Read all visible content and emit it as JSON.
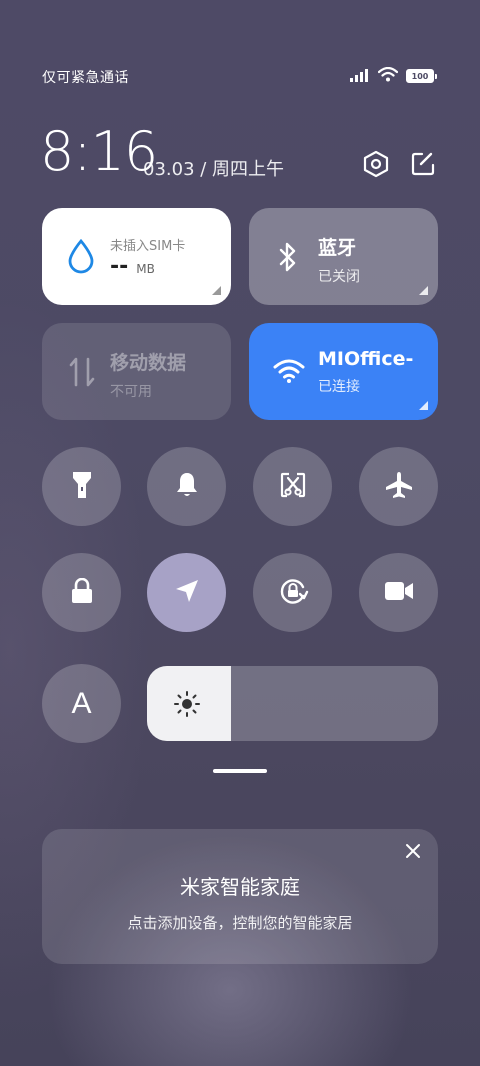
{
  "status_bar": {
    "carrier": "仅可紧急通话",
    "battery": "100",
    "icons": [
      "signal-icon",
      "wifi-icon",
      "battery-icon"
    ]
  },
  "header": {
    "time": "8:16",
    "date": "03.03 / 周四上午",
    "icons": [
      "settings-icon",
      "edit-icon"
    ]
  },
  "tiles": {
    "data_usage": {
      "label": "未插入SIM卡",
      "value": "--",
      "unit": "MB",
      "icon": "water-drop-icon"
    },
    "bluetooth": {
      "title": "蓝牙",
      "status": "已关闭",
      "icon": "bluetooth-icon"
    },
    "mobile_data": {
      "title": "移动数据",
      "status": "不可用",
      "icon": "data-arrows-icon"
    },
    "wifi": {
      "title": "MIOffice-",
      "status": "已连接",
      "icon": "wifi-icon",
      "accent": "#3b82f6"
    }
  },
  "toggles_row1": [
    "flashlight-icon",
    "bell-icon",
    "screenshot-icon",
    "airplane-icon"
  ],
  "toggles_row2": [
    "lock-icon",
    "location-icon",
    "rotation-lock-icon",
    "video-icon"
  ],
  "auto_brightness_label": "A",
  "brightness_level": 0.29,
  "card": {
    "title": "米家智能家庭",
    "subtitle": "点击添加设备，控制您的智能家居"
  }
}
